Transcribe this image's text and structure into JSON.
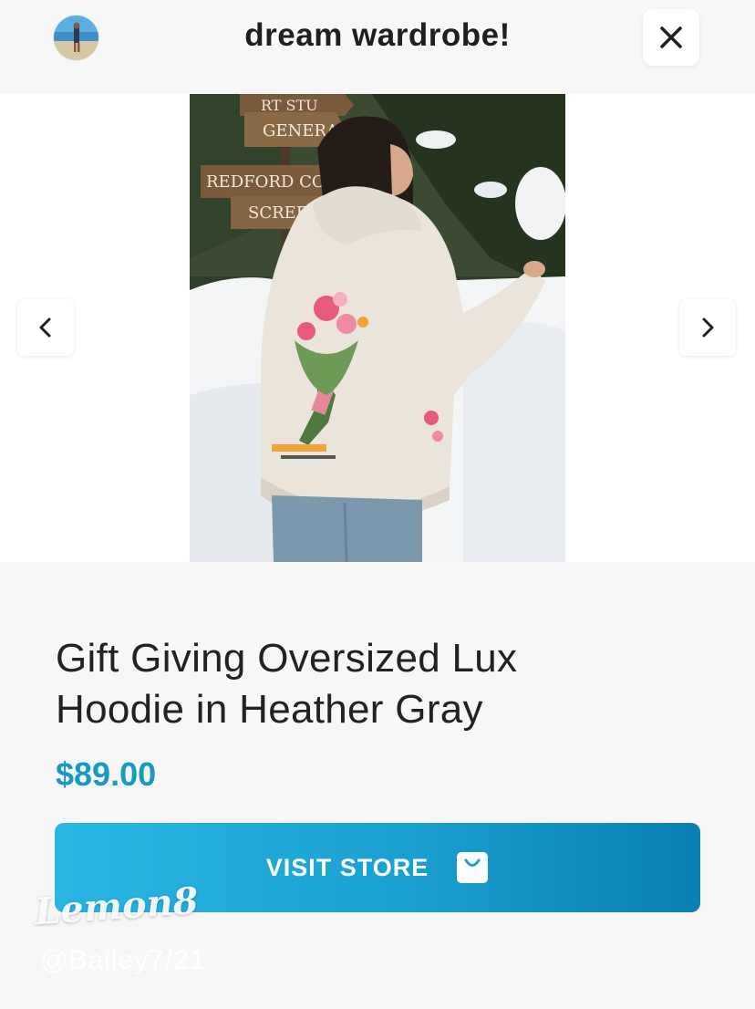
{
  "header": {
    "title": "dream wardrobe!"
  },
  "icons": {
    "close": "close-icon",
    "prev": "chevron-left-icon",
    "next": "chevron-right-icon",
    "bag": "shopping-bag-icon"
  },
  "product": {
    "name_line1": "Gift Giving Oversized Lux",
    "name_line2": "Hoodie in Heather Gray",
    "price": "$89.00",
    "image_signs": [
      "RT STU",
      "GENERA",
      "REDFORD CON",
      "SCREEN"
    ]
  },
  "cta": {
    "label": "VISIT STORE"
  },
  "watermark": {
    "brand": "Lemon8",
    "handle": "@Bailey7/21"
  },
  "colors": {
    "price": "#1799c0",
    "button_start": "#29b6e3",
    "button_end": "#0c7fb3"
  }
}
